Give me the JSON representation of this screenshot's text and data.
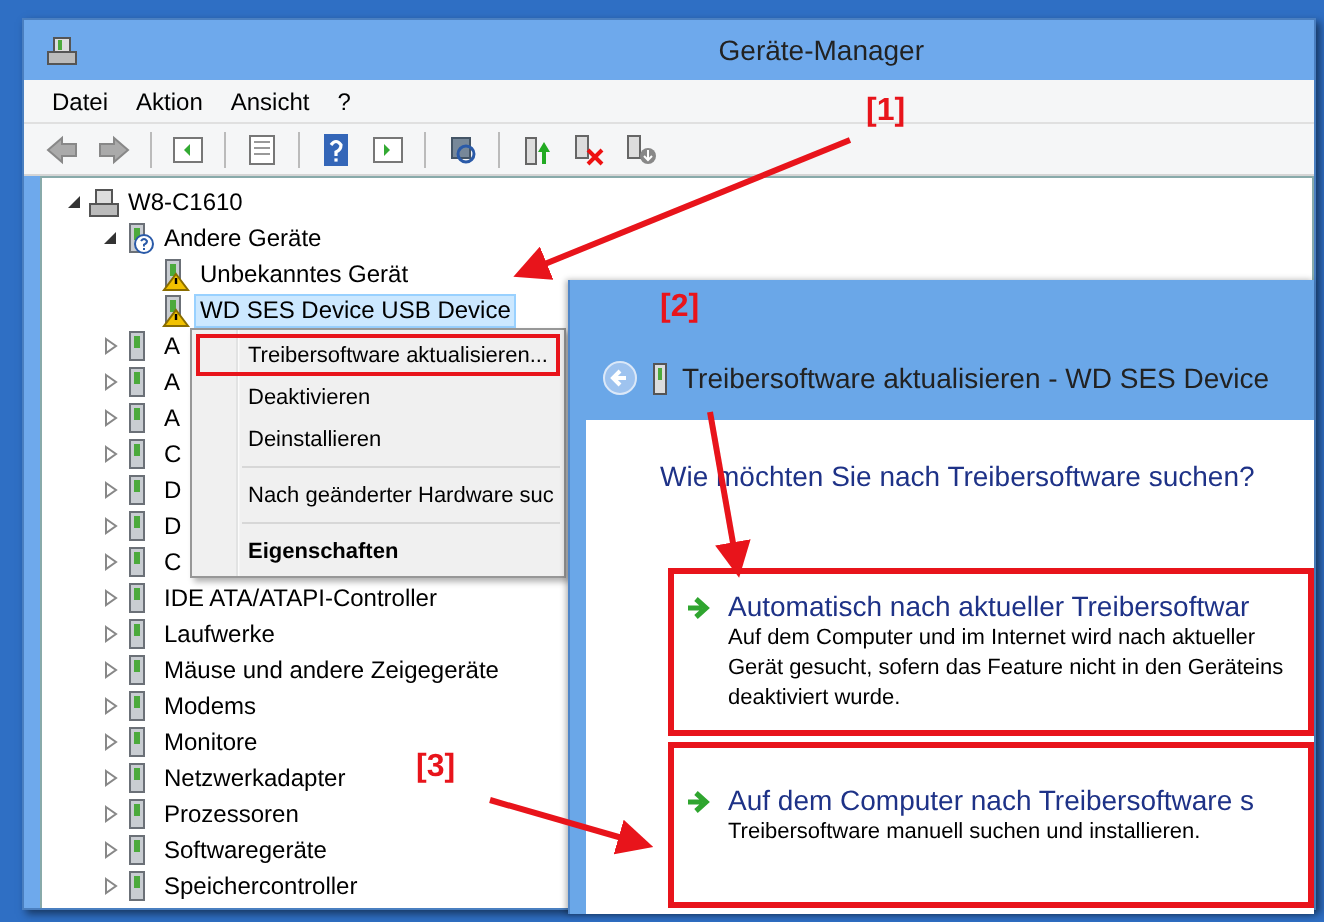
{
  "window": {
    "title": "Geräte-Manager"
  },
  "menu_bar": [
    "Datei",
    "Aktion",
    "Ansicht",
    "?"
  ],
  "tree": [
    {
      "label": "W8-C1610",
      "expanded": true,
      "selected": false,
      "children": [
        {
          "label": "Andere Geräte",
          "expanded": true,
          "selected": false,
          "children": [
            {
              "label": "Unbekanntes Gerät",
              "selected": false,
              "warning": true
            },
            {
              "label": "WD SES Device USB Device",
              "selected": true,
              "warning": true
            }
          ]
        },
        {
          "label": "A",
          "expanded": false,
          "selected": false
        },
        {
          "label": "A",
          "expanded": false,
          "selected": false
        },
        {
          "label": "A",
          "expanded": false,
          "selected": false
        },
        {
          "label": "C",
          "expanded": false,
          "selected": false
        },
        {
          "label": "D",
          "expanded": false,
          "selected": false
        },
        {
          "label": "D",
          "expanded": false,
          "selected": false
        },
        {
          "label": "C",
          "expanded": false,
          "selected": false
        },
        {
          "label": "IDE ATA/ATAPI-Controller",
          "expanded": false,
          "selected": false
        },
        {
          "label": "Laufwerke",
          "expanded": false,
          "selected": false
        },
        {
          "label": "Mäuse und andere Zeigegeräte",
          "expanded": false,
          "selected": false
        },
        {
          "label": "Modems",
          "expanded": false,
          "selected": false
        },
        {
          "label": "Monitore",
          "expanded": false,
          "selected": false
        },
        {
          "label": "Netzwerkadapter",
          "expanded": false,
          "selected": false
        },
        {
          "label": "Prozessoren",
          "expanded": false,
          "selected": false
        },
        {
          "label": "Softwaregeräte",
          "expanded": false,
          "selected": false
        },
        {
          "label": "Speichercontroller",
          "expanded": false,
          "selected": false
        }
      ]
    }
  ],
  "context_menu": [
    {
      "kind": "item",
      "label": "Treibersoftware aktualisieren...",
      "highlighted": true
    },
    {
      "kind": "item",
      "label": "Deaktivieren",
      "highlighted": false
    },
    {
      "kind": "item",
      "label": "Deinstallieren",
      "highlighted": false
    },
    {
      "kind": "separator"
    },
    {
      "kind": "item",
      "label": "Nach geänderter Hardware suc",
      "highlighted": false
    },
    {
      "kind": "separator"
    },
    {
      "kind": "default",
      "label": "Eigenschaften",
      "highlighted": false
    }
  ],
  "dialog": {
    "title": "Treibersoftware aktualisieren - WD SES Device",
    "heading": "Wie möchten Sie nach Treibersoftware suchen?",
    "options": [
      {
        "title": "Automatisch nach aktueller Treibersoftwar",
        "description_lines": [
          "Auf dem Computer und im Internet wird nach aktueller",
          "Gerät gesucht, sofern das Feature nicht in den Geräteins",
          "deaktiviert wurde."
        ],
        "highlighted": true
      },
      {
        "title": "Auf dem Computer nach Treibersoftware s",
        "description_lines": [
          "Treibersoftware manuell suchen und installieren."
        ],
        "highlighted": true
      }
    ]
  },
  "annotations": [
    {
      "label": "[1]"
    },
    {
      "label": "[2]"
    },
    {
      "label": "[3]"
    }
  ]
}
